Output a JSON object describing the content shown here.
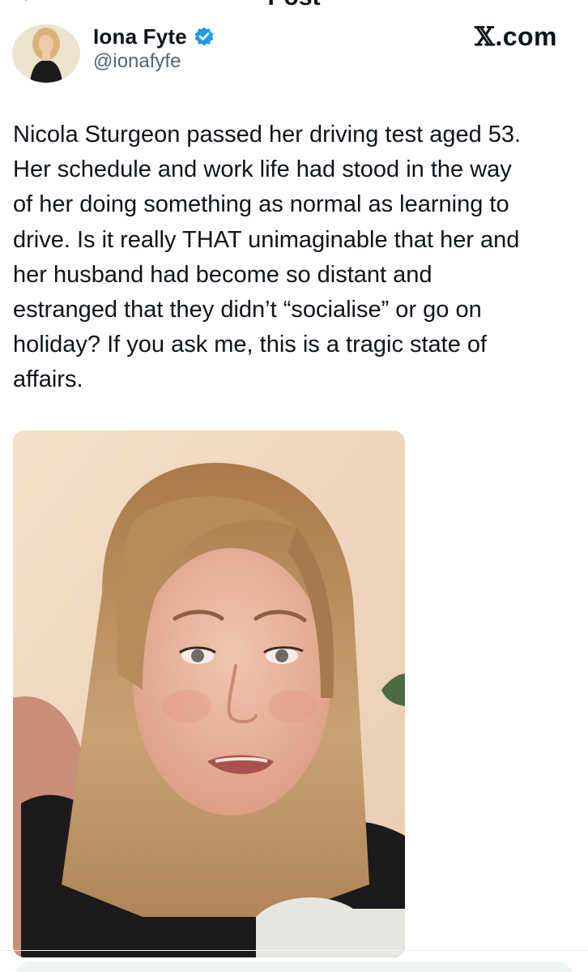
{
  "header": {
    "title": "Post"
  },
  "author": {
    "name": "Iona Fyte",
    "handle": "@ionafyfe",
    "verified": true
  },
  "source": {
    "site_label": ".com",
    "site_glyph": "𝕏"
  },
  "tweet": {
    "text": "Nicola Sturgeon passed her driving test aged 53.\nHer schedule and work life had stood in the way\nof her doing something as normal as learning to\ndrive. Is it really THAT unimaginable that her and\nher husband had become so distant and\nestranged that they didn’t “socialise” or go on\nholiday? If you ask me, this is a tragic state of\naffairs."
  },
  "colors": {
    "verified_blue": "#1d9bf0",
    "text_primary": "#0f1419",
    "text_secondary": "#536471"
  },
  "icons": {
    "back": "arrow-left-icon",
    "verified": "verified-badge-icon"
  }
}
